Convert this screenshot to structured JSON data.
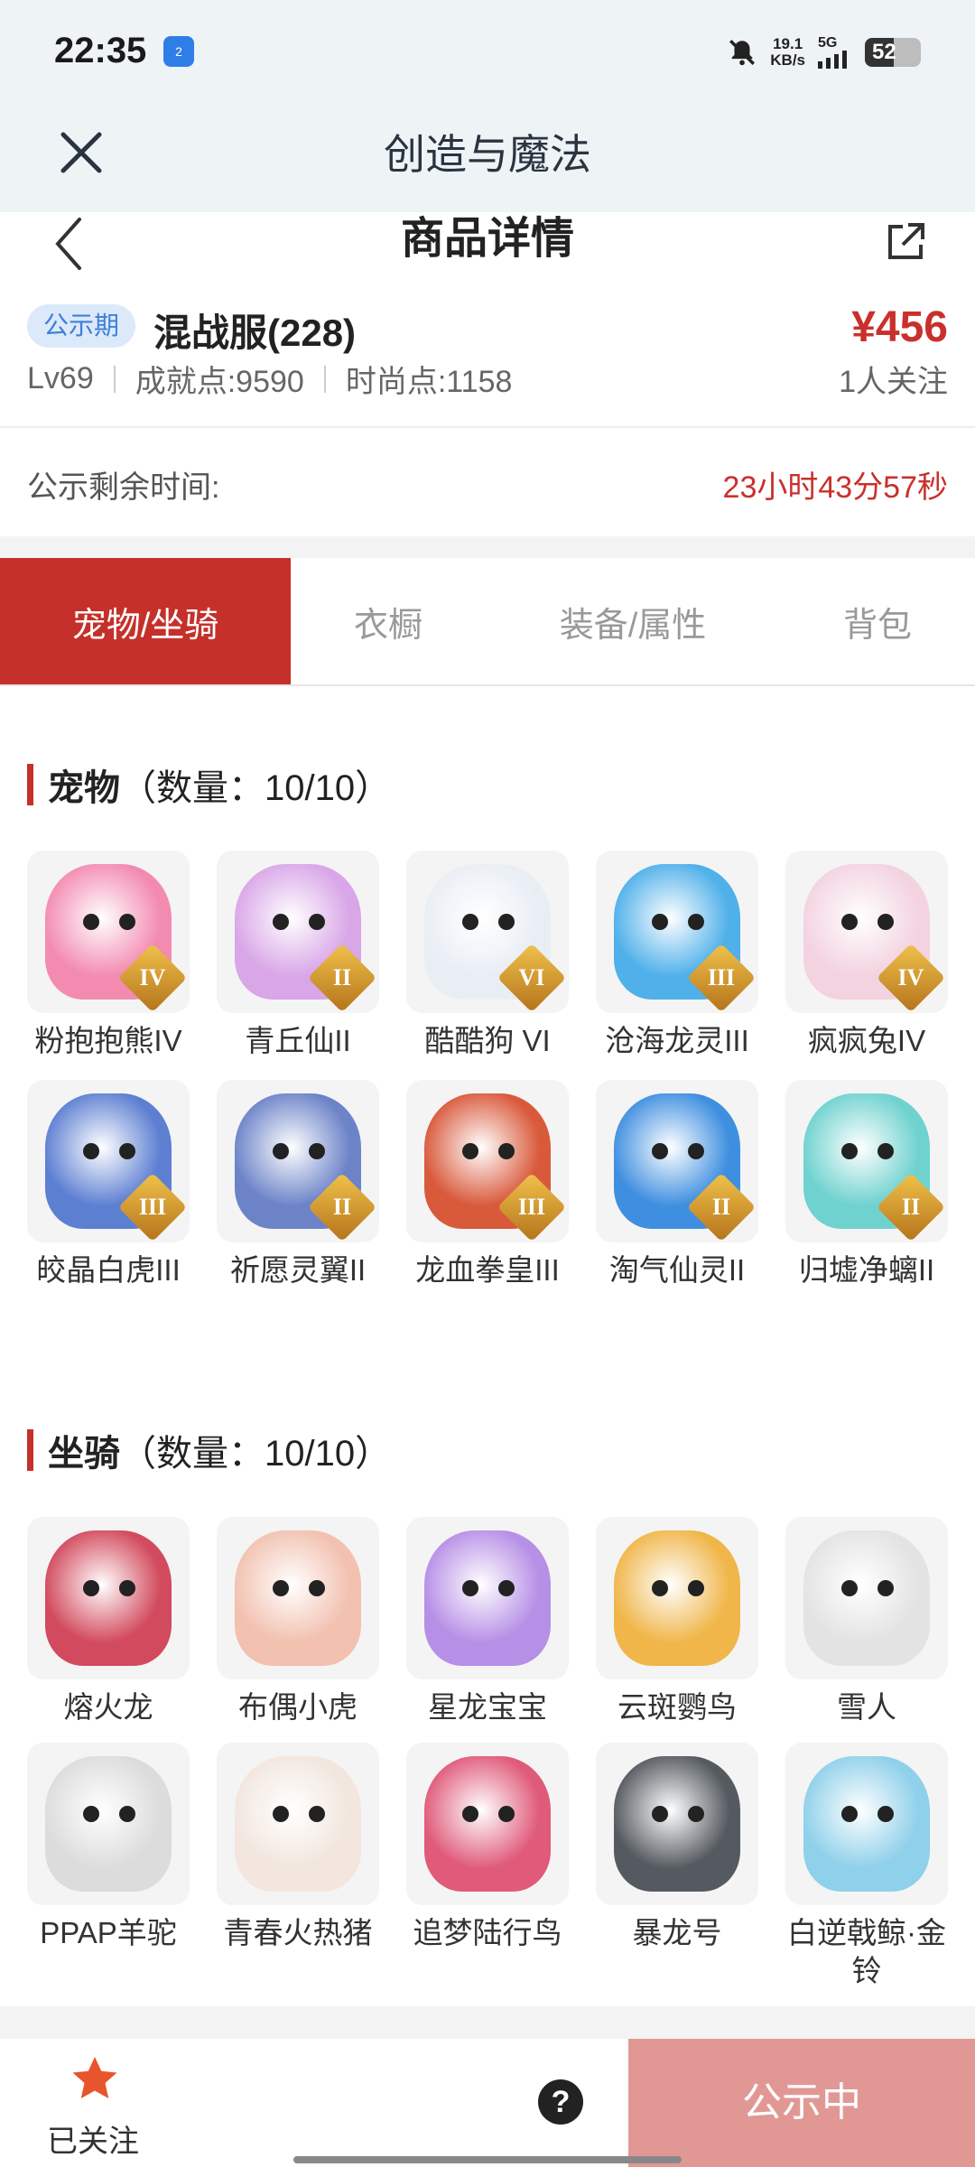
{
  "status": {
    "time": "22:35",
    "nfc": "2",
    "speed": "19.1",
    "speed_unit": "KB/s",
    "network": "5G",
    "battery": "52",
    "battery_level": 0.52
  },
  "web": {
    "title": "创造与魔法"
  },
  "page": {
    "title": "商品详情"
  },
  "product": {
    "badge": "公示期",
    "name": "混战服(228)",
    "price": "¥456",
    "level": "Lv69",
    "achievement": "成就点:9590",
    "fashion": "时尚点:1158",
    "followers": "1人关注",
    "remain_label": "公示剩余时间:",
    "remain_value": "23小时43分57秒"
  },
  "tabs": [
    {
      "label": "宠物/坐骑",
      "active": true
    },
    {
      "label": "衣橱",
      "active": false
    },
    {
      "label": "装备/属性",
      "active": false
    },
    {
      "label": "背包",
      "active": false
    }
  ],
  "pets": {
    "title": "宠物",
    "count": "（数量：10/10）",
    "items": [
      {
        "name": "粉抱抱熊IV",
        "rank": "IV",
        "color": "#f38bb1"
      },
      {
        "name": "青丘仙II",
        "rank": "II",
        "color": "#d9a6e8"
      },
      {
        "name": "酷酷狗 VI",
        "rank": "VI",
        "color": "#e9eef5"
      },
      {
        "name": "沧海龙灵III",
        "rank": "III",
        "color": "#4fb0ea"
      },
      {
        "name": "疯疯兔IV",
        "rank": "IV",
        "color": "#f3d3e0"
      },
      {
        "name": "皎晶白虎III",
        "rank": "III",
        "color": "#5d7fd2"
      },
      {
        "name": "祈愿灵翼II",
        "rank": "II",
        "color": "#6c83c8"
      },
      {
        "name": "龙血拳皇III",
        "rank": "III",
        "color": "#d9593b"
      },
      {
        "name": "淘气仙灵II",
        "rank": "II",
        "color": "#3f8fe0"
      },
      {
        "name": "归墟净螭II",
        "rank": "II",
        "color": "#6fd2cf"
      }
    ]
  },
  "mounts": {
    "title": "坐骑",
    "count": "（数量：10/10）",
    "items": [
      {
        "name": "熔火龙",
        "color": "#d24a5d"
      },
      {
        "name": "布偶小虎",
        "color": "#f2c1b0"
      },
      {
        "name": "星龙宝宝",
        "color": "#b68fe6"
      },
      {
        "name": "云斑鹦鸟",
        "color": "#f0b64a"
      },
      {
        "name": "雪人",
        "color": "#e3e3e3"
      },
      {
        "name": "PPAP羊驼",
        "color": "#dcdcdc"
      },
      {
        "name": "青春火热猪",
        "color": "#f2e6de"
      },
      {
        "name": "追梦陆行鸟",
        "color": "#e05a7a"
      },
      {
        "name": "暴龙号",
        "color": "#555a60"
      },
      {
        "name": "白逆戟鲸·金铃",
        "color": "#8fd0ea"
      }
    ]
  },
  "bottom": {
    "follow_label": "已关注",
    "help": "?",
    "status_button": "公示中"
  }
}
